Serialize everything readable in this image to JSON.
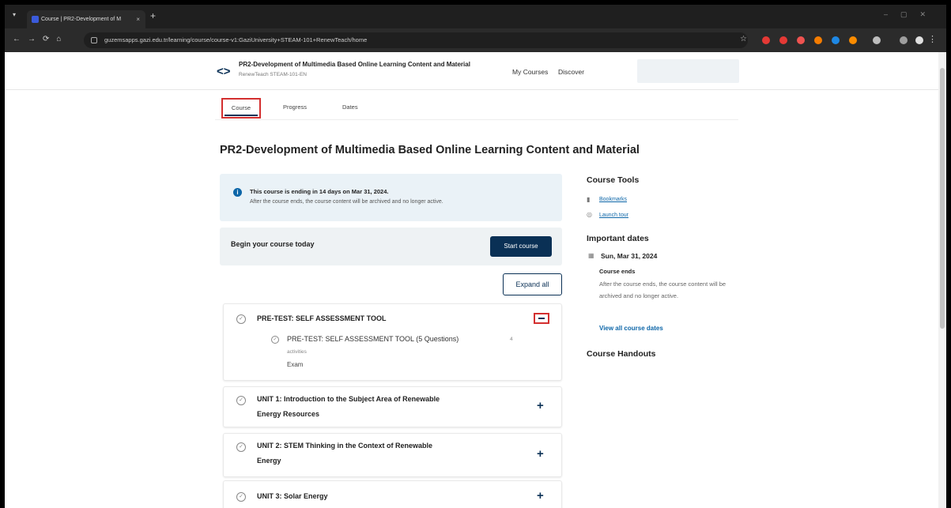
{
  "browser": {
    "tab_title": "Course | PR2-Development of M",
    "tab_close": "×",
    "new_tab": "+",
    "url": "guzemsapps.gazi.edu.tr/learning/course/course-v1:GaziUniversity+STEAM-101+RenewTeach/home"
  },
  "header": {
    "logo": "<>",
    "course_title": "PR2-Development of Multimedia Based Online Learning Content and Material",
    "course_subtitle": "RenewTeach STEAM-101-EN",
    "nav_my_courses": "My Courses",
    "nav_discover": "Discover"
  },
  "tabs": {
    "course": "Course",
    "progress": "Progress",
    "dates": "Dates"
  },
  "main": {
    "title": "PR2-Development of Multimedia Based Online Learning Content and Material",
    "alert_line1": "This course is ending in 14 days on Mar 31, 2024.",
    "alert_line2": "After the course ends, the course content will be archived and no longer active.",
    "begin_text": "Begin your course today",
    "start_button": "Start course",
    "expand_button": "Expand all"
  },
  "sections": [
    {
      "title": "PRE-TEST: SELF ASSESSMENT TOOL",
      "sub_title": "PRE-TEST: SELF ASSESSMENT TOOL (5 Questions)",
      "sub_count": "4",
      "sub_activities": "activities",
      "sub_type": "Exam"
    },
    {
      "title_line1": "UNIT 1: Introduction to the Subject Area of Renewable",
      "title_line2": "Energy Resources"
    },
    {
      "title_line1": "UNIT 2: STEM Thinking in the Context of Renewable",
      "title_line2": "Energy"
    },
    {
      "title_line1": "UNIT 3: Solar Energy"
    }
  ],
  "sidebar": {
    "tools_heading": "Course Tools",
    "bookmarks": "Bookmarks",
    "launch_tour": "Launch tour",
    "dates_heading": "Important dates",
    "date": "Sun, Mar 31, 2024",
    "course_ends": "Course ends",
    "course_ends_desc": "After the course ends, the course content will be archived and no longer active.",
    "view_all": "View all course dates",
    "handouts_heading": "Course Handouts"
  },
  "colors": {
    "brand": "#0a3055",
    "link": "#0d66a8",
    "highlight": "#d32f2f",
    "alert_bg": "#eaf2f7"
  }
}
